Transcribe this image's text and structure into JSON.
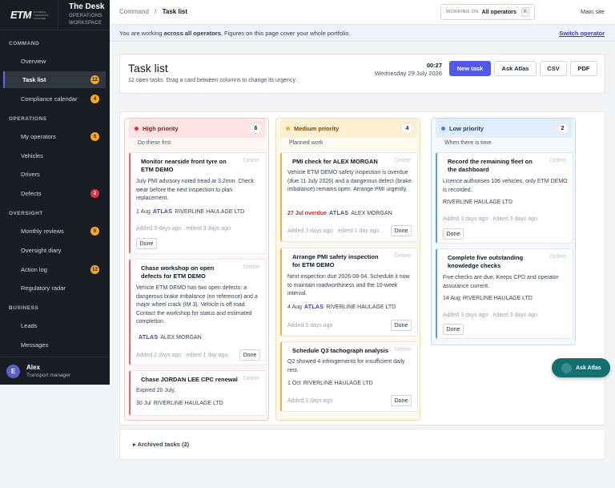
{
  "brand": {
    "logo": "ETM",
    "logo_sub": "EXTERNAL TRANSPORT MANAGER",
    "title": "The Desk",
    "subtitle_line1": "OPERATIONS",
    "subtitle_line2": "WORKSPACE"
  },
  "sidebar": {
    "sections": [
      {
        "label": "COMMAND",
        "items": [
          {
            "label": "Overview"
          },
          {
            "label": "Task list",
            "active": true,
            "badge": "12"
          },
          {
            "label": "Compliance calendar",
            "badge": "4"
          }
        ]
      },
      {
        "label": "OPERATIONS",
        "items": [
          {
            "label": "My operators",
            "badge": "6"
          },
          {
            "label": "Vehicles"
          },
          {
            "label": "Drivers"
          },
          {
            "label": "Defects",
            "badge": "2"
          }
        ]
      },
      {
        "label": "OVERSIGHT",
        "items": [
          {
            "label": "Monthly reviews",
            "badge": "6"
          },
          {
            "label": "Oversight diary"
          },
          {
            "label": "Action log",
            "badge": "12"
          },
          {
            "label": "Regulatory radar"
          }
        ]
      },
      {
        "label": "BUSINESS",
        "items": [
          {
            "label": "Leads"
          },
          {
            "label": "Messages"
          }
        ]
      }
    ],
    "user": {
      "initial": "E",
      "name": "Alex",
      "role": "Transport manager"
    }
  },
  "topbar": {
    "breadcrumb_parent": "Command",
    "breadcrumb_sep": "/",
    "breadcrumb_current": "Task list",
    "working_on_label": "WORKING ON",
    "working_on_value": "All operators",
    "shortcut_key": "K",
    "main_site": "Main site"
  },
  "notice": {
    "prefix": "You are working ",
    "bold": "across all operators",
    "suffix": ". Figures on this page cover your whole portfolio.",
    "link": "Switch operator"
  },
  "header": {
    "title": "Task list",
    "subtitle": "12 open tasks. Drag a card between columns to change its urgency.",
    "time": "00:27",
    "date": "Wednesday 29 July 2026",
    "buttons": {
      "new_task": "New task",
      "ask_atlas": "Ask Atlas",
      "csv": "CSV",
      "pdf": "PDF"
    }
  },
  "columns": [
    {
      "title": "High priority",
      "count": "6",
      "hint": "Do these first",
      "color": "#dc3545",
      "cards": [
        {
          "title": "Monitor nearside front tyre on ETM DEMO",
          "delete": "Delete",
          "body": "July PMI advisory noted tread at 3.2mm. Check wear before the next inspection to plan replacement.",
          "date": "1 Aug",
          "atlas": "ATLAS",
          "who": "RIVERLINE HAULAGE LTD",
          "foot": "Added 3 days ago · edited 3 days ago",
          "done": "Done"
        },
        {
          "title": "Chase workshop on open defects for ETM DEMO",
          "delete": "Delete",
          "body": "Vehicle ETM DEMO has two open defects: a dangerous brake imbalance (no reference) and a major wheel crack (IM 3). Vehicle is off road. Contact the workshop for status and estimated completion.",
          "date": "",
          "atlas": "ATLAS",
          "who": "ALEX MORGAN",
          "foot": "Added 2 days ago · edited 1 day ago",
          "done": "Done"
        },
        {
          "title": "Chase JORDAN LEE CPC renewal",
          "delete": "Delete",
          "body": "Expired 20 July.",
          "date": "30 Jul",
          "atlas": "",
          "who": "RIVERLINE HAULAGE LTD",
          "foot": "",
          "done": ""
        }
      ]
    },
    {
      "title": "Medium priority",
      "count": "4",
      "hint": "Planned work",
      "color": "#f0b13a",
      "cards": [
        {
          "title": "PMI check for ALEX MORGAN",
          "delete": "Delete",
          "body": "Vehicle ETM DEMO safety inspection is overdue (due 11 July 2026) and a dangerous defect (brake imbalance) remains open. Arrange PMI urgently.",
          "date": "27 Jul overdue",
          "atlas": "ATLAS",
          "who": "ALEX MORGAN",
          "foot": "Added 3 days ago · edited 1 day ago",
          "done": "Done"
        },
        {
          "title": "Arrange PMI safety inspection for ETM DEMO",
          "delete": "Delete",
          "body": "Next inspection due 2026-08-04. Schedule it now to maintain roadworthiness and the 10-week interval.",
          "date": "4 Aug",
          "atlas": "ATLAS",
          "who": "RIVERLINE HAULAGE LTD",
          "foot": "Added 3 days ago",
          "done": "Done"
        },
        {
          "title": "Schedule Q3 tachograph analysis",
          "delete": "Delete",
          "body": "Q2 showed 4 infringements for insufficient daily rest.",
          "date": "1 Oct",
          "atlas": "",
          "who": "RIVERLINE HAULAGE LTD",
          "foot": "Added 3 days ago",
          "done": "Done"
        }
      ]
    },
    {
      "title": "Low priority",
      "count": "2",
      "hint": "When there is time",
      "color": "#3b82f6",
      "cards": [
        {
          "title": "Record the remaining fleet on the dashboard",
          "delete": "Delete",
          "body": "Licence authorises 106 vehicles, only ETM DEMO is recorded.",
          "date": "",
          "atlas": "",
          "who": "RIVERLINE HAULAGE LTD",
          "foot": "Added 3 days ago · edited 3 days ago",
          "done": "Done"
        },
        {
          "title": "Complete five outstanding knowledge checks",
          "delete": "Delete",
          "body": "Five checks are due. Keeps CPD and operator assurance current.",
          "date": "14 Aug",
          "atlas": "",
          "who": "RIVERLINE HAULAGE LTD",
          "foot": "Added 3 days ago · edited 3 days ago",
          "done": "Done"
        }
      ]
    }
  ],
  "archived": {
    "label": "▸ Archived tasks (2)"
  },
  "fab": {
    "label": "Ask Atlas"
  }
}
